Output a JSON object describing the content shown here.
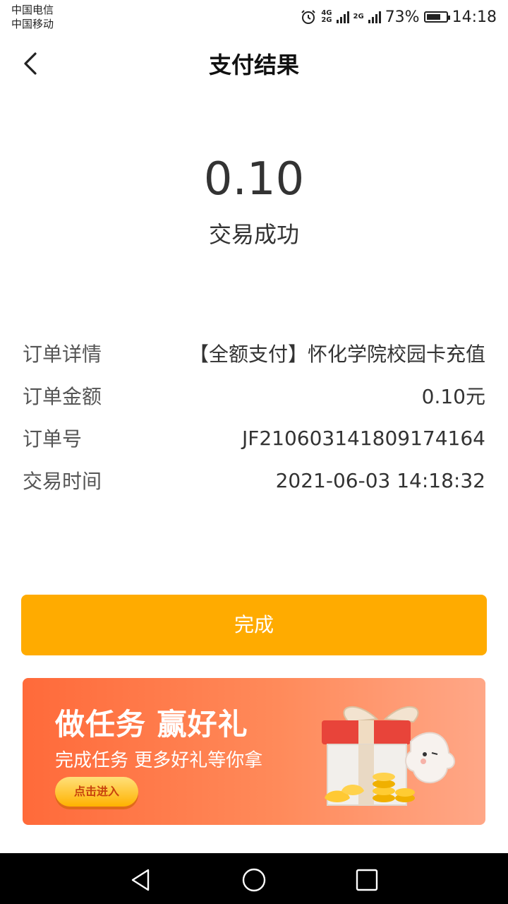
{
  "status_bar": {
    "carrier_1": "中国电信",
    "carrier_2": "中国移动",
    "net_1_top": "4G",
    "net_1_bottom": "2G",
    "net_2": "2G",
    "battery_pct": "73%",
    "battery_level": 0.73,
    "time": "14:18"
  },
  "header": {
    "title": "支付结果"
  },
  "summary": {
    "amount": "0.10",
    "status": "交易成功"
  },
  "details": [
    {
      "label": "订单详情",
      "value": "【全额支付】怀化学院校园卡充值"
    },
    {
      "label": "订单金额",
      "value": "0.10元"
    },
    {
      "label": "订单号",
      "value": "JF2106031418091741​64"
    },
    {
      "label": "交易时间",
      "value": "2021-06-03 14:18:32"
    }
  ],
  "actions": {
    "done_label": "完成"
  },
  "banner": {
    "title": "做任务 赢好礼",
    "subtitle": "完成任务 更多好礼等你拿",
    "button_label": "点击进入"
  },
  "colors": {
    "accent": "#ffab00",
    "banner_start": "#ff6a3a",
    "banner_end": "#ffa787"
  }
}
